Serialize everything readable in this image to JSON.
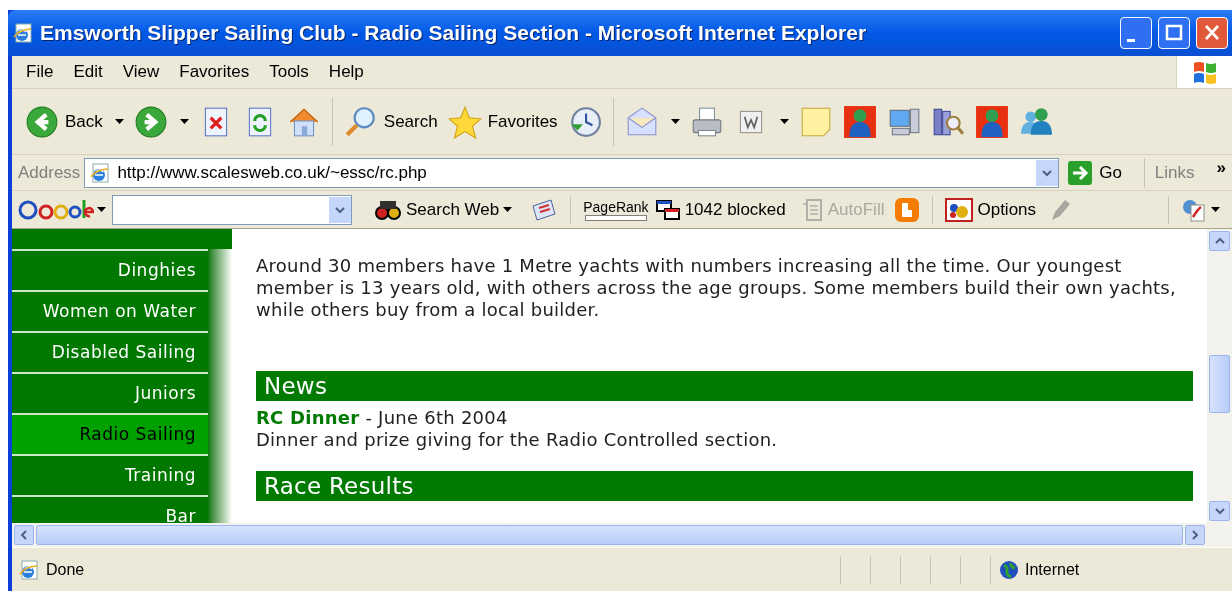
{
  "window": {
    "title": "Emsworth Slipper Sailing Club - Radio Sailing Section - Microsoft Internet Explorer"
  },
  "menu": [
    "File",
    "Edit",
    "View",
    "Favorites",
    "Tools",
    "Help"
  ],
  "toolbar": [
    {
      "kind": "back",
      "label": "Back",
      "dropdown": true
    },
    {
      "kind": "forward",
      "dropdown": true
    },
    {
      "kind": "stop"
    },
    {
      "kind": "refresh"
    },
    {
      "kind": "home"
    },
    {
      "kind": "separator"
    },
    {
      "kind": "search",
      "label": "Search"
    },
    {
      "kind": "favorites",
      "label": "Favorites"
    },
    {
      "kind": "history"
    },
    {
      "kind": "separator"
    },
    {
      "kind": "mail",
      "dropdown": true
    },
    {
      "kind": "print"
    },
    {
      "kind": "edit",
      "dropdown": true
    },
    {
      "kind": "note"
    },
    {
      "kind": "messenger"
    },
    {
      "kind": "computer"
    },
    {
      "kind": "research"
    },
    {
      "kind": "messenger"
    },
    {
      "kind": "contacts"
    }
  ],
  "address": {
    "label": "Address",
    "value": "http://www.scalesweb.co.uk/~essc/rc.php",
    "go": "Go",
    "links": "Links",
    "more": "»"
  },
  "google_bar": {
    "search_button": "Search Web",
    "pagerank": "PageRank",
    "blocked": "1042 blocked",
    "autofill": {
      "label": "AutoFill",
      "disabled": true
    },
    "options": "Options"
  },
  "sidebar": {
    "items": [
      {
        "label": "Dinghies",
        "selected": false
      },
      {
        "label": "Women on Water",
        "selected": false
      },
      {
        "label": "Disabled Sailing",
        "selected": false
      },
      {
        "label": "Juniors",
        "selected": false
      },
      {
        "label": "Radio Sailing",
        "selected": true
      },
      {
        "label": "Training",
        "selected": false
      },
      {
        "label": "Bar",
        "selected": false
      }
    ]
  },
  "content": {
    "paragraph": "Around 30 members have 1 Metre yachts with numbers increasing all the time. Our youngest member is 13 years old, with others across the age groups. Some members build their own yachts, while others buy from a local builder.",
    "sections": [
      {
        "heading": "News",
        "items": [
          {
            "title": "**RC Dinner** - June 6th 2004",
            "text": "Dinner and prize giving for the Radio Controlled section."
          }
        ]
      },
      {
        "heading": "Race Results"
      }
    ]
  },
  "status_bar": {
    "text": "Done",
    "zone": "Internet"
  }
}
